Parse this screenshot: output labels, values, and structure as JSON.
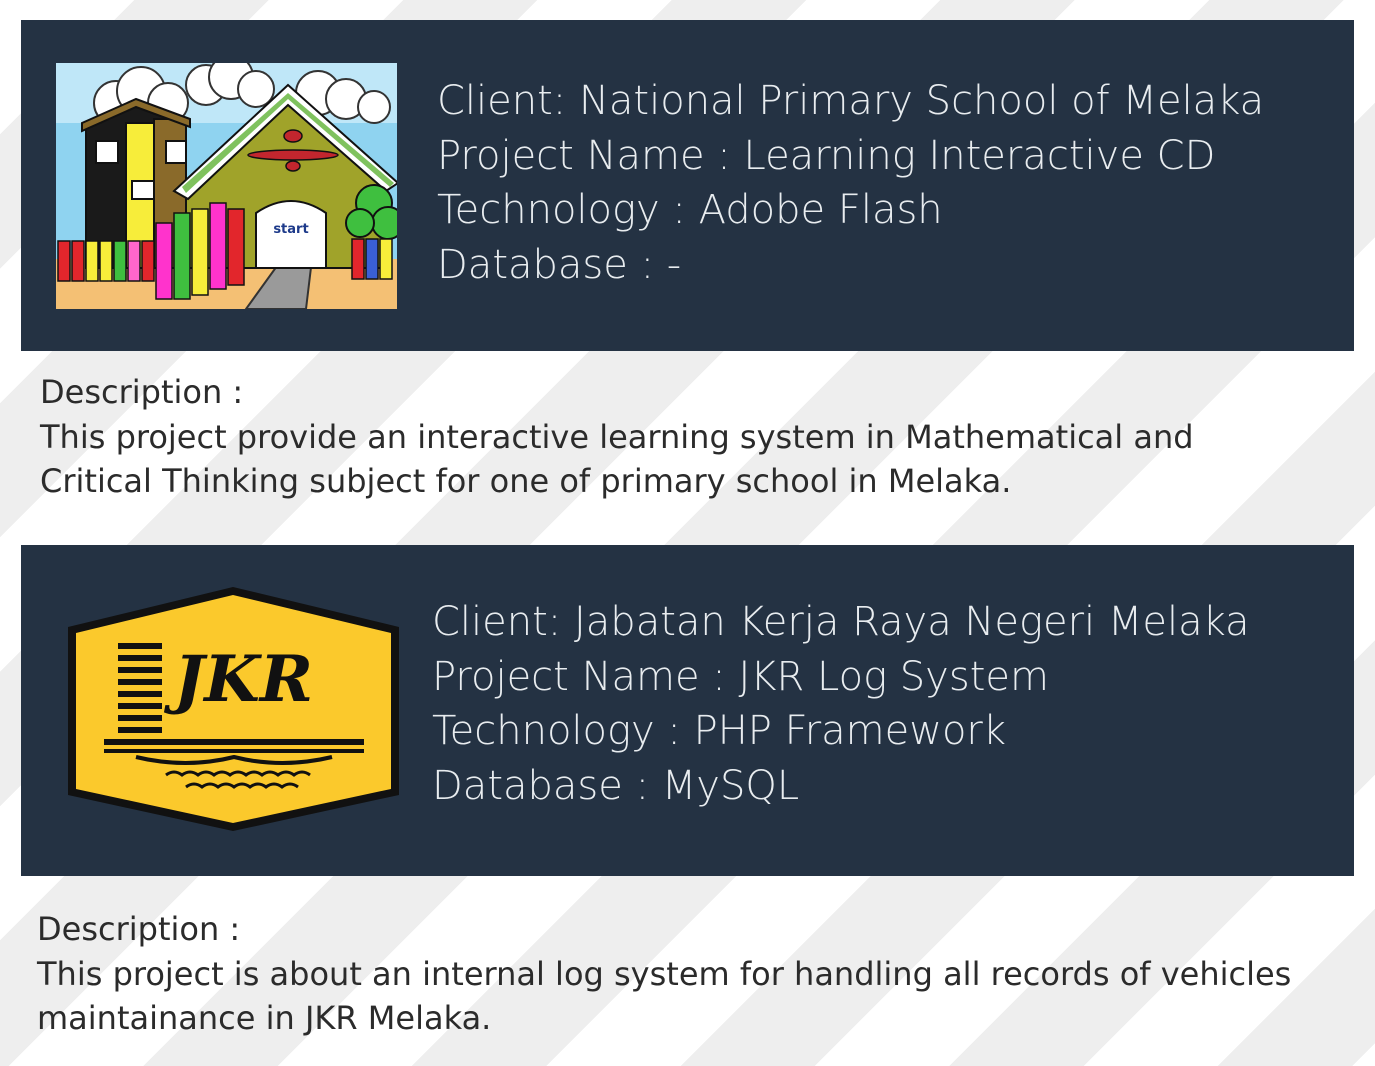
{
  "projects": [
    {
      "image": {
        "label": "start",
        "icon": "school-cd-illustration"
      },
      "client": "Client: National Primary School of Melaka",
      "project_name": "Project Name : Learning Interactive CD",
      "technology": "Technology : Adobe Flash",
      "database": "Database : -",
      "description_heading": "Description :",
      "description_lines": [
        "This project provide an interactive learning system in Mathematical and",
        "Critical Thinking subject for one of primary school in Melaka."
      ]
    },
    {
      "image": {
        "label": "JKR",
        "icon": "jkr-logo"
      },
      "client": "Client: Jabatan Kerja Raya Negeri Melaka",
      "project_name": "Project Name : JKR Log System",
      "technology": "Technology : PHP Framework",
      "database": "Database : MySQL",
      "description_heading": "Description :",
      "description_lines": [
        "This project is about an internal log system for handling all records of vehicles",
        "maintainance in JKR Melaka."
      ]
    }
  ],
  "colors": {
    "panel": "#243243",
    "panel_text": "#e8ecef",
    "description_text": "#2b2b2b",
    "logo_yellow": "#fbc92c"
  }
}
